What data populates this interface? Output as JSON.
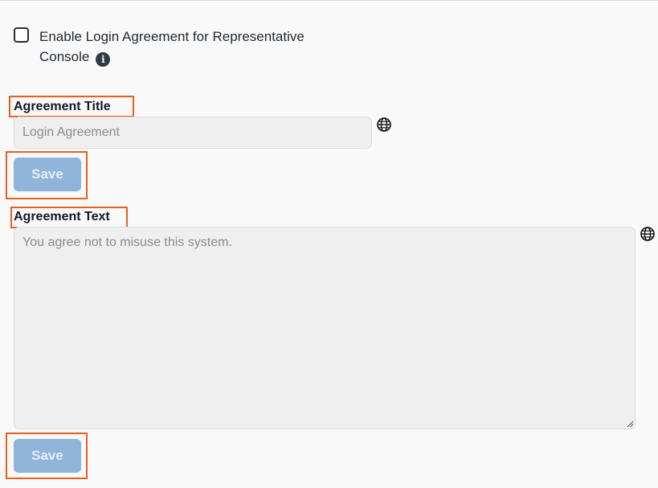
{
  "login_agreement": {
    "enable_checkbox": {
      "checked": false,
      "label": "Enable Login Agreement for Representative Console",
      "info_icon": "info-icon"
    },
    "title_field": {
      "label": "Agreement Title",
      "placeholder": "Login Agreement",
      "value": "",
      "language_icon": "globe-icon"
    },
    "title_save_label": "Save",
    "text_field": {
      "label": "Agreement Text",
      "placeholder": "You agree not to misuse this system.",
      "value": "",
      "language_icon": "globe-icon"
    },
    "text_save_label": "Save"
  },
  "colors": {
    "highlight": "#e8601f",
    "button_disabled_bg": "#8fb3d9",
    "input_bg": "#efefef"
  }
}
